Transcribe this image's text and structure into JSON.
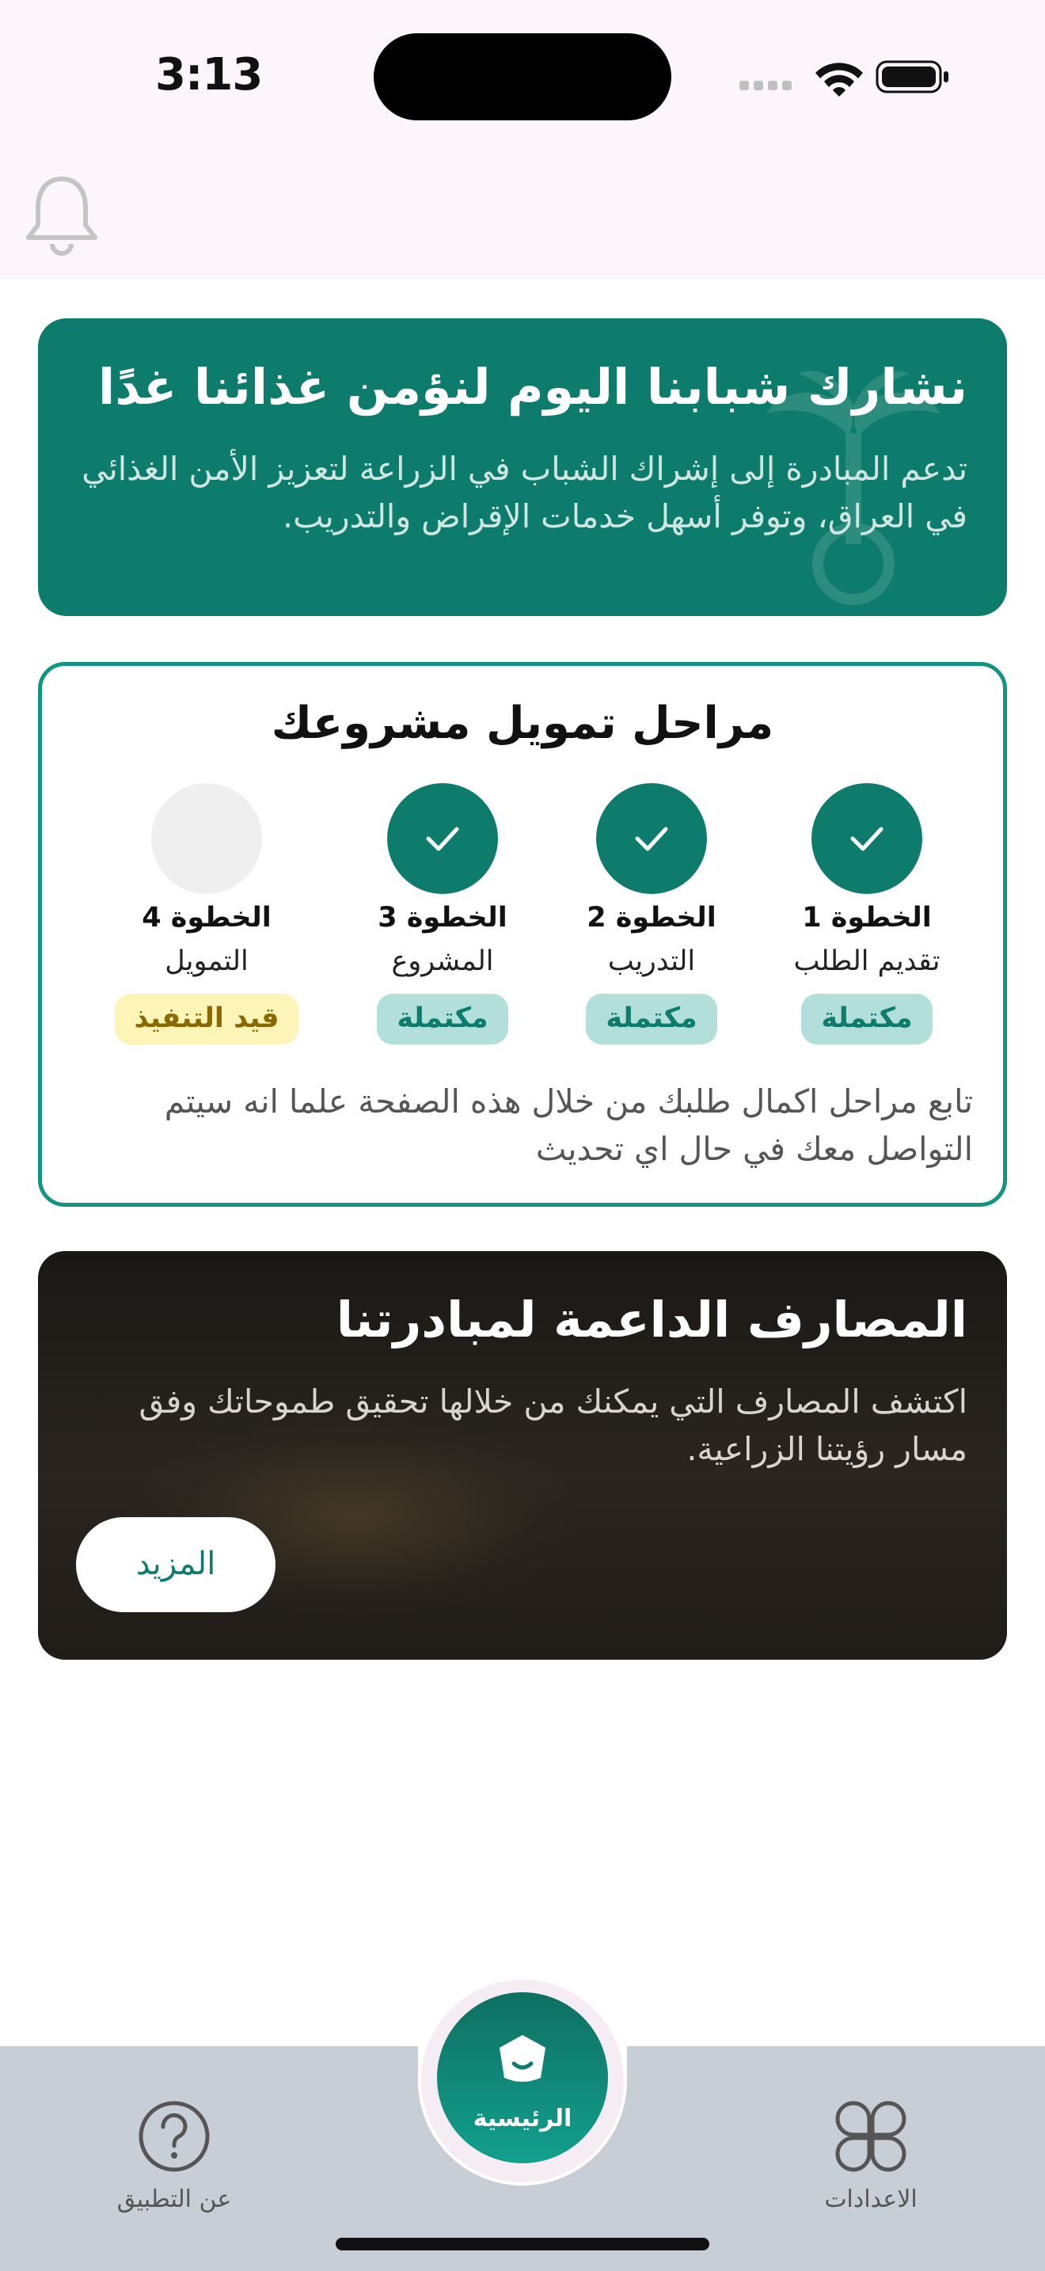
{
  "status_bar": {
    "time": "3:13"
  },
  "header": {
    "bell_icon": "bell-icon"
  },
  "banner": {
    "title": "نشارك شبابنا اليوم لنؤمن غذائنا غدًا",
    "description": "تدعم المبادرة إلى إشراك الشباب في الزراعة لتعزيز الأمن الغذائي في العراق، وتوفر أسهل خدمات الإقراض والتدريب.",
    "background_color": "#0e7c6c"
  },
  "stages": {
    "title": "مراحل تمويل مشروعك",
    "steps": [
      {
        "title": "الخطوة 1",
        "subtitle": "تقديم الطلب",
        "status": "مكتملة",
        "completed": true
      },
      {
        "title": "الخطوة 2",
        "subtitle": "التدريب",
        "status": "مكتملة",
        "completed": true
      },
      {
        "title": "الخطوة 3",
        "subtitle": "المشروع",
        "status": "مكتملة",
        "completed": true
      },
      {
        "title": "الخطوة 4",
        "subtitle": "التمويل",
        "status": "قيد التنفيذ",
        "completed": false
      }
    ],
    "note": "تابع مراحل اكمال طلبك من خلال هذه الصفحة علما انه سيتم التواصل معك في حال اي تحديث",
    "accent_color": "#129482"
  },
  "banks": {
    "title": "المصارف الداعمة لمبادرتنا",
    "description": "اكتشف المصارف التي يمكنك من خلالها تحقيق طموحاتك وفق مسار رؤيتنا الزراعية.",
    "more_label": "المزيد"
  },
  "bottom_nav": {
    "items": [
      {
        "label": "الاعدادات",
        "icon": "settings-grid-icon"
      },
      {
        "label": "الرئيسية",
        "icon": "home-icon",
        "active": true
      },
      {
        "label": "عن التطبيق",
        "icon": "help-circle-icon"
      }
    ]
  }
}
